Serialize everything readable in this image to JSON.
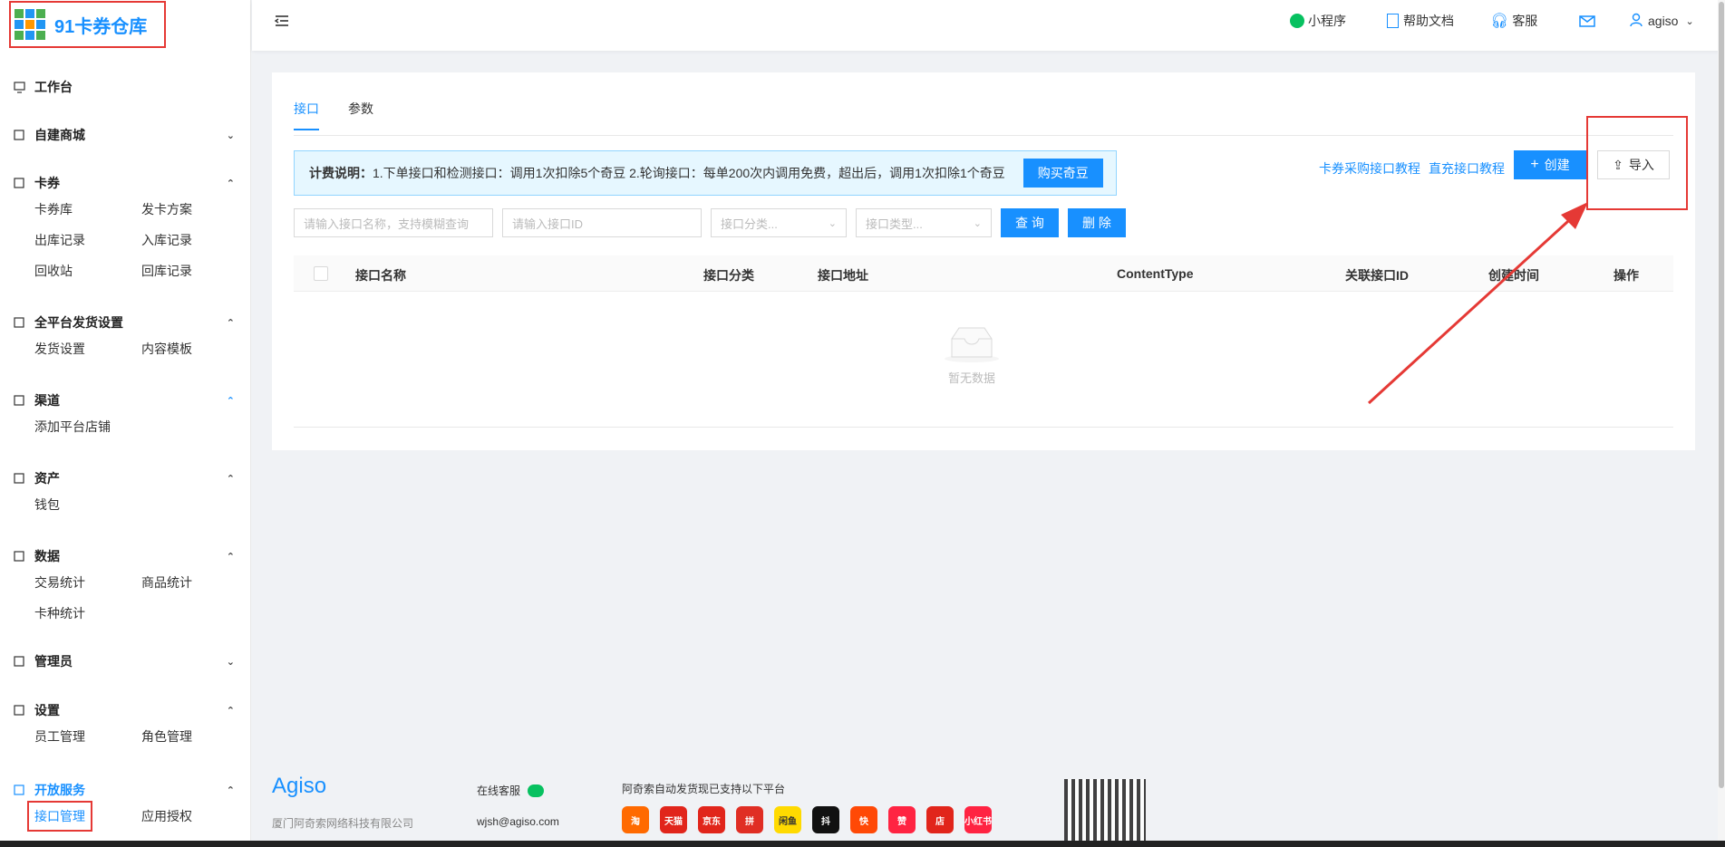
{
  "logo": {
    "text": "91卡券仓库"
  },
  "header": {
    "items": [
      "小程序",
      "帮助文档",
      "客服"
    ],
    "user": "agiso"
  },
  "sidebar": {
    "workbench": "工作台",
    "groups": [
      {
        "title": "自建商城",
        "arrow": "⌄",
        "items": []
      },
      {
        "title": "卡券",
        "arrow": "⌃",
        "items": [
          "卡券库",
          "发卡方案",
          "出库记录",
          "入库记录",
          "回收站",
          "回库记录"
        ]
      },
      {
        "title": "全平台发货设置",
        "arrow": "⌃",
        "items": [
          "发货设置",
          "内容模板"
        ]
      },
      {
        "title": "渠道",
        "arrow": "⌃",
        "items": [
          "添加平台店铺"
        ]
      },
      {
        "title": "资产",
        "arrow": "⌃",
        "items": [
          "钱包"
        ]
      },
      {
        "title": "数据",
        "arrow": "⌃",
        "items": [
          "交易统计",
          "商品统计",
          "卡种统计"
        ]
      },
      {
        "title": "管理员",
        "arrow": "⌄",
        "items": []
      },
      {
        "title": "设置",
        "arrow": "⌃",
        "items": [
          "员工管理",
          "角色管理"
        ]
      },
      {
        "title": "开放服务",
        "arrow": "⌃",
        "items": [
          "接口管理",
          "应用授权"
        ]
      }
    ]
  },
  "main": {
    "tabs": [
      "接口",
      "参数"
    ],
    "notice_label": "计费说明：",
    "notice_text": "1.下单接口和检测接口：调用1次扣除5个奇豆  2.轮询接口：每单200次内调用免费，超出后，调用1次扣除1个奇豆",
    "buy_button": "购买奇豆",
    "link_card": "卡券采购接口教程",
    "link_direct": "直充接口教程",
    "create_button": "创建",
    "import_button": "导入",
    "filters": {
      "name_placeholder": "请输入接口名称，支持模糊查询",
      "id_placeholder": "请输入接口ID",
      "category_placeholder": "接口分类...",
      "type_placeholder": "接口类型..."
    },
    "query_button": "查 询",
    "delete_button": "删 除",
    "columns": [
      "接口名称",
      "接口分类",
      "接口地址",
      "ContentType",
      "关联接口ID",
      "创建时间",
      "操作"
    ],
    "empty_text": "暂无数据"
  },
  "footer": {
    "brand": "Agiso",
    "company": "厦门阿奇索网络科技有限公司",
    "online_service": "在线客服",
    "email": "wjsh@agiso.com",
    "platforms_title": "阿奇索自动发货现已支持以下平台",
    "platforms": [
      {
        "label": "淘",
        "color": "#ff6a00"
      },
      {
        "label": "天猫",
        "color": "#e1251b"
      },
      {
        "label": "京东",
        "color": "#e1251b"
      },
      {
        "label": "拼",
        "color": "#e02e24"
      },
      {
        "label": "闲鱼",
        "color": "#ffda00"
      },
      {
        "label": "抖",
        "color": "#111111"
      },
      {
        "label": "快",
        "color": "#ff4906"
      },
      {
        "label": "赞",
        "color": "#ff2442"
      },
      {
        "label": "店",
        "color": "#e1251b"
      },
      {
        "label": "小红书",
        "color": "#ff2442"
      }
    ]
  },
  "colors": {
    "accent": "#1890ff",
    "annotation": "#e53935"
  }
}
